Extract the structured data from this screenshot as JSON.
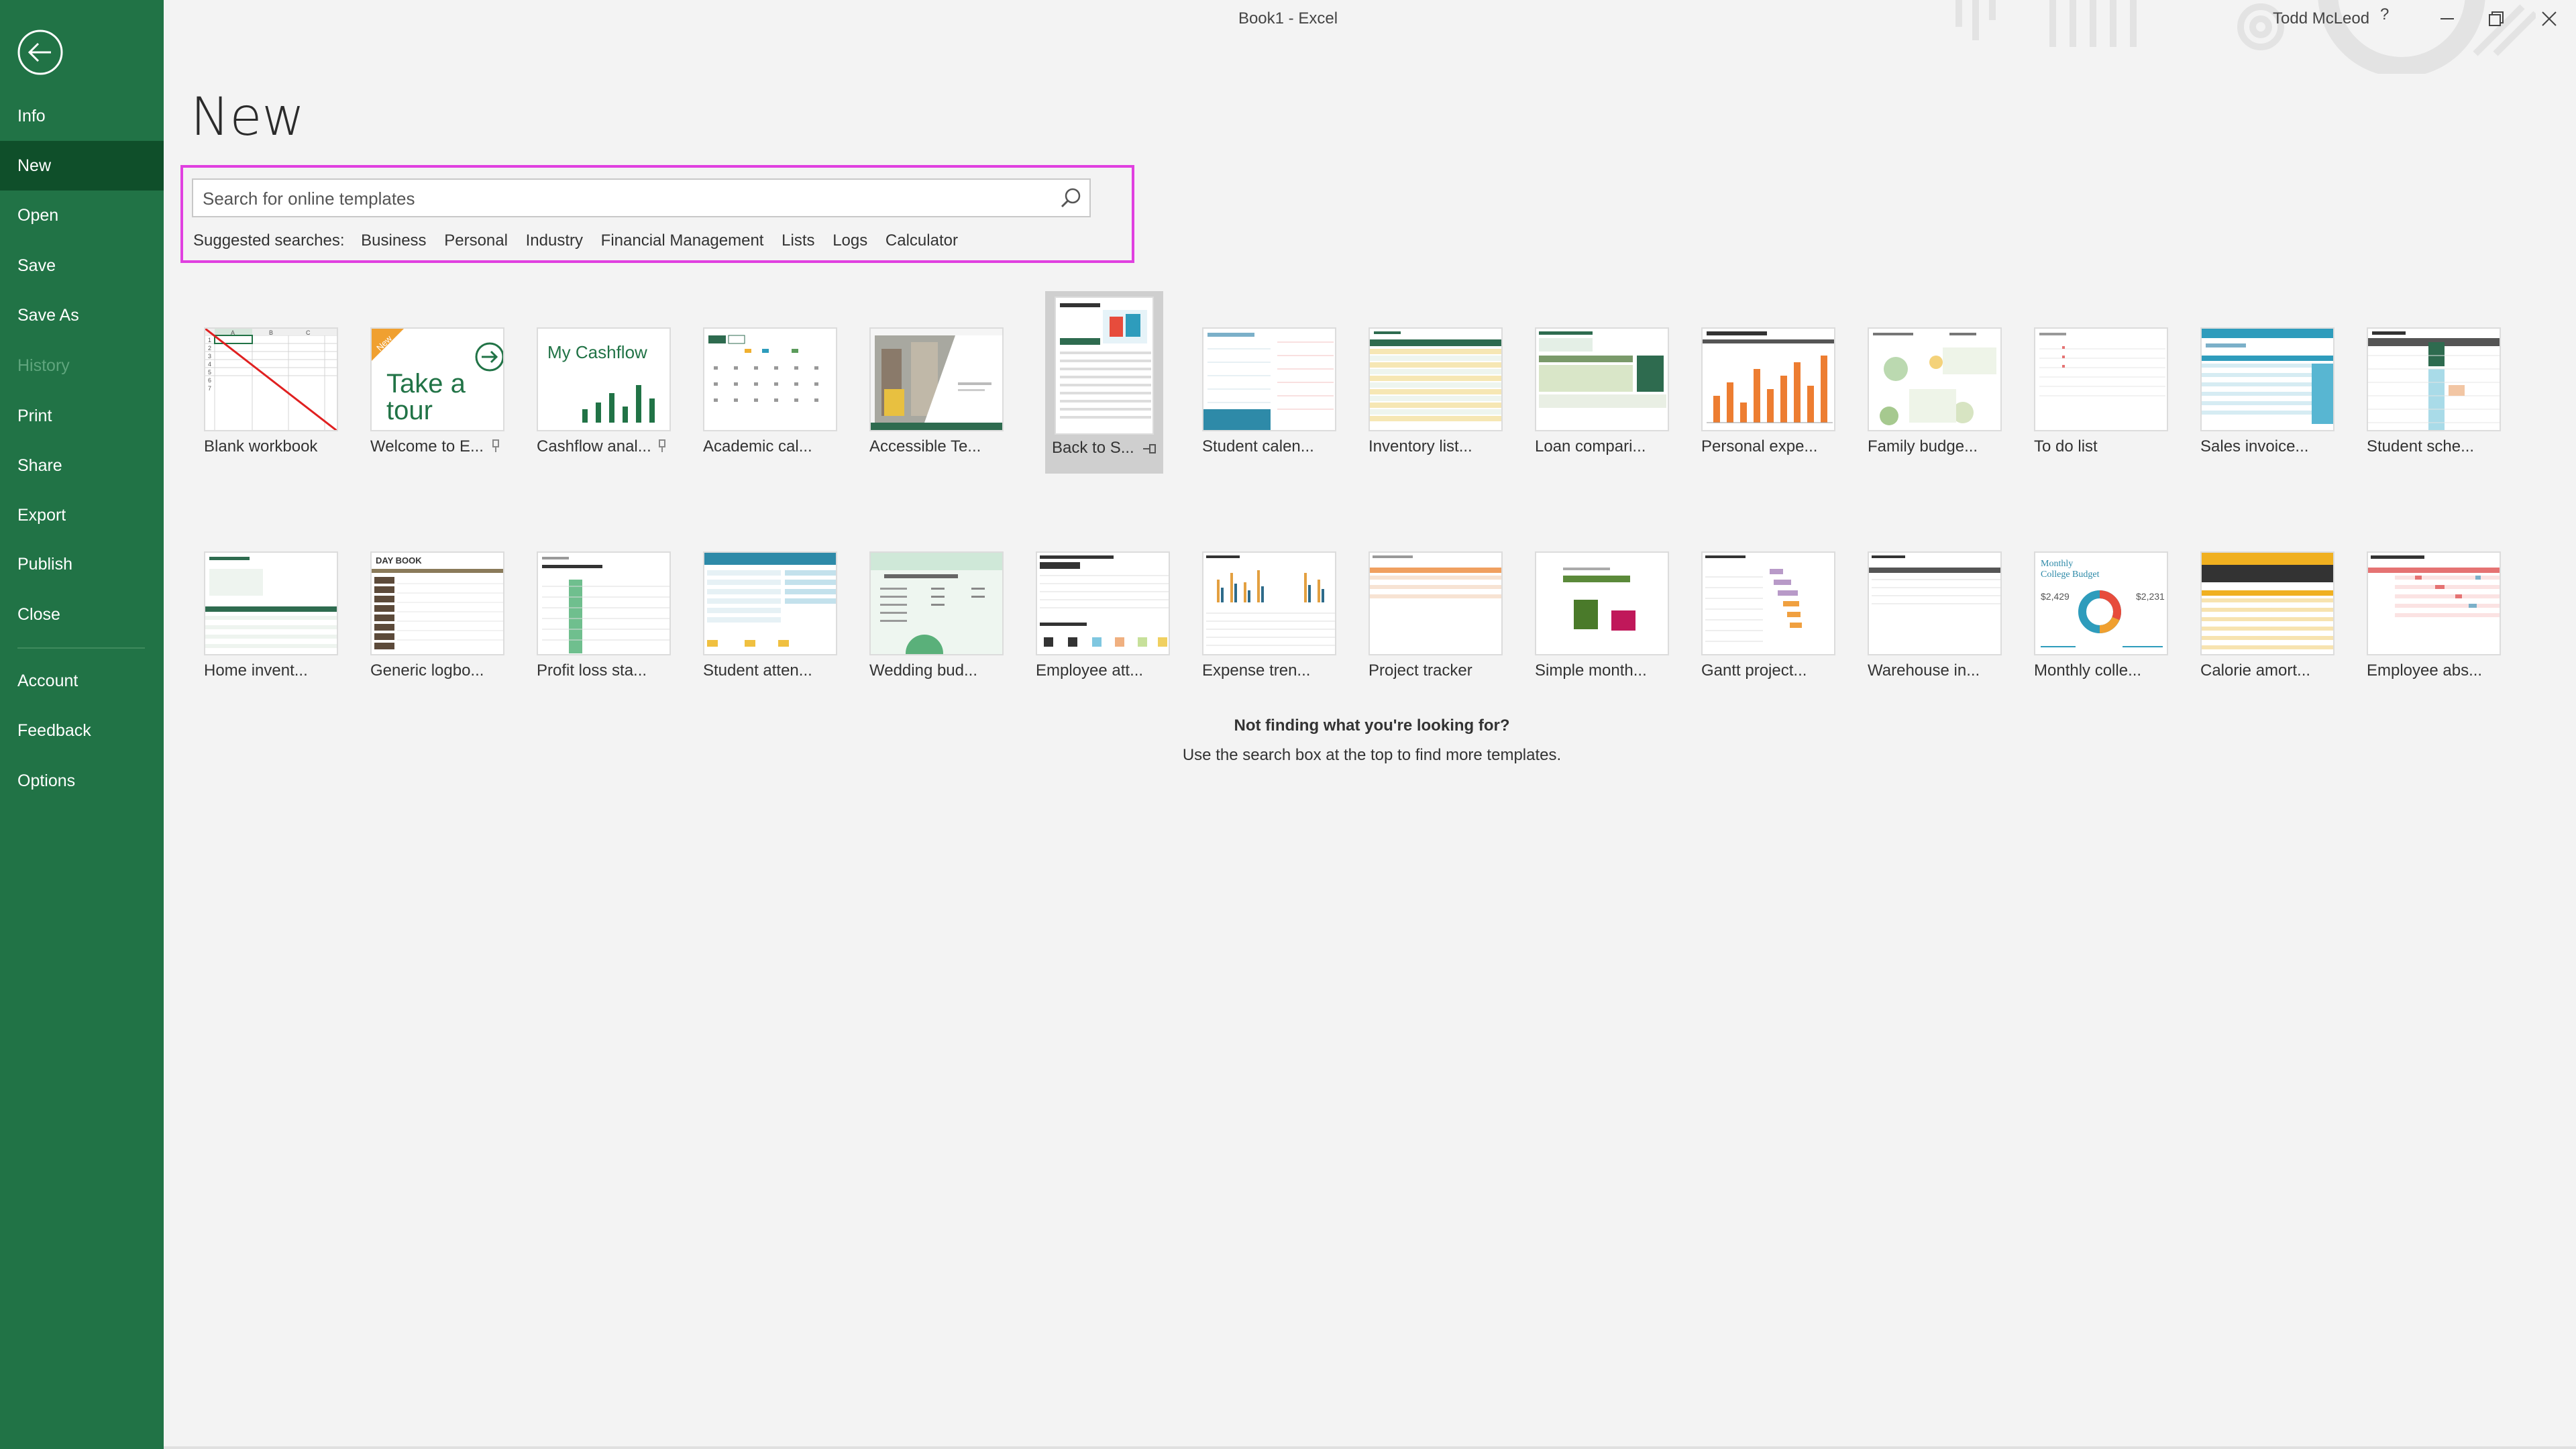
{
  "window": {
    "title": "Book1  -  Excel",
    "user": "Todd McLeod",
    "help": "?"
  },
  "sidebar": {
    "items": [
      {
        "label": "Info"
      },
      {
        "label": "New"
      },
      {
        "label": "Open"
      },
      {
        "label": "Save"
      },
      {
        "label": "Save As"
      },
      {
        "label": "History"
      },
      {
        "label": "Print"
      },
      {
        "label": "Share"
      },
      {
        "label": "Export"
      },
      {
        "label": "Publish"
      },
      {
        "label": "Close"
      },
      {
        "label": "Account"
      },
      {
        "label": "Feedback"
      },
      {
        "label": "Options"
      }
    ]
  },
  "main": {
    "title": "New",
    "search": {
      "placeholder": "Search for online templates"
    },
    "suggested": {
      "label": "Suggested searches:",
      "links": [
        "Business",
        "Personal",
        "Industry",
        "Financial Management",
        "Lists",
        "Logs",
        "Calculator"
      ]
    },
    "templates": [
      {
        "label": "Blank workbook"
      },
      {
        "label": "Welcome to E...",
        "badge": "New",
        "thumb_text_1": "Take a",
        "thumb_text_2": "tour"
      },
      {
        "label": "Cashflow anal...",
        "thumb_text": "My Cashflow"
      },
      {
        "label": "Academic cal..."
      },
      {
        "label": "Accessible Te..."
      },
      {
        "label": "Back to S..."
      },
      {
        "label": "Student calen..."
      },
      {
        "label": "Inventory list..."
      },
      {
        "label": "Loan compari..."
      },
      {
        "label": "Personal expe..."
      },
      {
        "label": "Family budge..."
      },
      {
        "label": "To do list"
      },
      {
        "label": "Sales invoice..."
      },
      {
        "label": "Student sche..."
      },
      {
        "label": "Home invent..."
      },
      {
        "label": "Generic logbo...",
        "thumb_text": "DAY BOOK"
      },
      {
        "label": "Profit loss sta..."
      },
      {
        "label": "Student atten..."
      },
      {
        "label": "Wedding bud..."
      },
      {
        "label": "Employee att..."
      },
      {
        "label": "Expense tren..."
      },
      {
        "label": "Project tracker"
      },
      {
        "label": "Simple month..."
      },
      {
        "label": "Gantt project..."
      },
      {
        "label": "Warehouse in..."
      },
      {
        "label": "Monthly colle...",
        "thumb_text_1": "Monthly",
        "thumb_text_2": "College Budget",
        "thumb_val_1": "$2,429",
        "thumb_val_2": "$2,231"
      },
      {
        "label": "Calorie amort..."
      },
      {
        "label": "Employee abs..."
      }
    ],
    "not_finding": {
      "title": "Not finding what you're looking for?",
      "subtitle": "Use the search box at the top to find more templates."
    }
  },
  "colors": {
    "sidebar_bg": "#217346",
    "sidebar_active": "#0f4f2a",
    "search_highlight": "#e040e0",
    "accent_orange": "#ed7d31",
    "accent_teal": "#2e9cbc"
  }
}
